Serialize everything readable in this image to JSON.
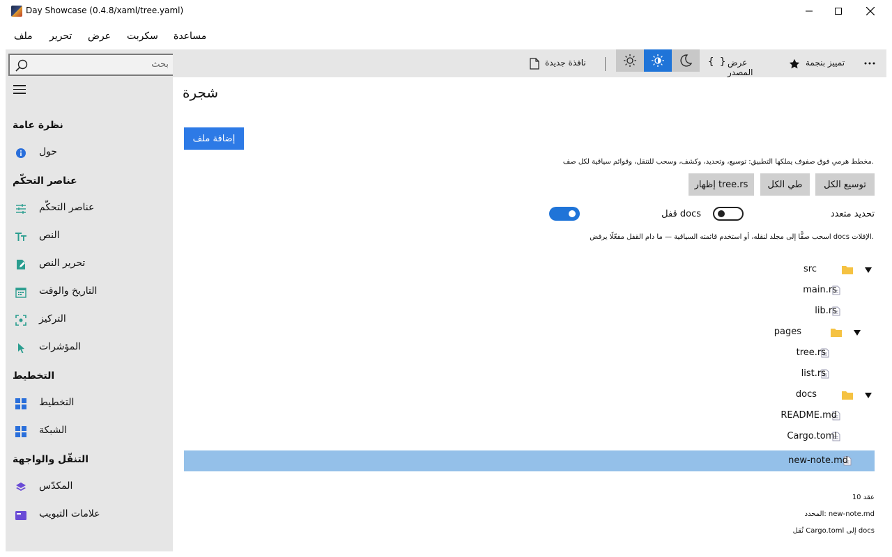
{
  "window": {
    "title": "Day Showcase (0.4.8/xaml/tree.yaml)"
  },
  "menu": [
    "مساعدة",
    "سكربت",
    "عرض",
    "تحرير",
    "ملف"
  ],
  "sidebar": {
    "search_placeholder": "بحث",
    "sections": [
      {
        "title": "نظرة عامة",
        "items": [
          {
            "label": "حول",
            "icon": "info-icon"
          }
        ]
      },
      {
        "title": "عناصر التحكّم",
        "items": [
          {
            "label": "عناصر التحكّم",
            "icon": "sliders-icon"
          },
          {
            "label": "النص",
            "icon": "text-icon"
          },
          {
            "label": "تحرير النص",
            "icon": "edit-icon"
          },
          {
            "label": "التاريخ والوقت",
            "icon": "calendar-icon"
          },
          {
            "label": "التركيز",
            "icon": "focus-icon"
          },
          {
            "label": "المؤشرات",
            "icon": "pointer-icon"
          }
        ]
      },
      {
        "title": "التخطيط",
        "items": [
          {
            "label": "التخطيط",
            "icon": "layout-icon"
          },
          {
            "label": "الشبكة",
            "icon": "grid-icon"
          }
        ]
      },
      {
        "title": "التنقّل والواجهة",
        "items": [
          {
            "label": "المكدّس",
            "icon": "layers-icon"
          },
          {
            "label": "علامات التبويب",
            "icon": "tabs-icon"
          }
        ]
      }
    ]
  },
  "toolbar": {
    "new_window": "نافذة جديدة",
    "view_source": "عرض المصدر",
    "star": "تمييز بنجمة",
    "theme_active": "auto"
  },
  "page": {
    "title": "شجرة",
    "add_file": "إضافة ملف",
    "description": "مخطط هرمي فوق صفوف يملكها التطبيق: توسيع، وتحديد، وكشف، وسحب للتنقل، وقوائم سياقية لكل صف.",
    "expand_all": "توسيع الكل",
    "collapse_all": "طي الكل",
    "reveal": "إظهار tree.rs",
    "multi_select_label": "تحديد متعدد",
    "multi_select_on": false,
    "lock_docs_label": "قفل docs",
    "lock_docs_on": true,
    "hint": "اسحب صفًّا إلى مجلد لنقله، أو استخدم قائمته السياقية — ما دام القفل مفعّلًا يرفض docs الإفلات."
  },
  "tree": [
    {
      "label": "src",
      "type": "folder",
      "depth": 0,
      "expanded": true
    },
    {
      "label": "main.rs",
      "type": "file",
      "depth": 1
    },
    {
      "label": "lib.rs",
      "type": "file",
      "depth": 1
    },
    {
      "label": "pages",
      "type": "folder",
      "depth": 1,
      "expanded": true
    },
    {
      "label": "tree.rs",
      "type": "file",
      "depth": 2
    },
    {
      "label": "list.rs",
      "type": "file",
      "depth": 2
    },
    {
      "label": "docs",
      "type": "folder",
      "depth": 0,
      "expanded": true
    },
    {
      "label": "README.md",
      "type": "file",
      "depth": 1
    },
    {
      "label": "Cargo.toml",
      "type": "file",
      "depth": 1
    },
    {
      "label": "new-note.md",
      "type": "file",
      "depth": 1,
      "selected": true
    }
  ],
  "status": {
    "count": "10 عقد",
    "selected": "المحدد: new-note.md",
    "moved": "نُقل Cargo.toml إلى docs"
  },
  "colors": {
    "accent": "#2d7ae6",
    "selection": "#94c0e9",
    "sidebar_bg": "#e6e6e6",
    "folder": "#f5c242"
  }
}
